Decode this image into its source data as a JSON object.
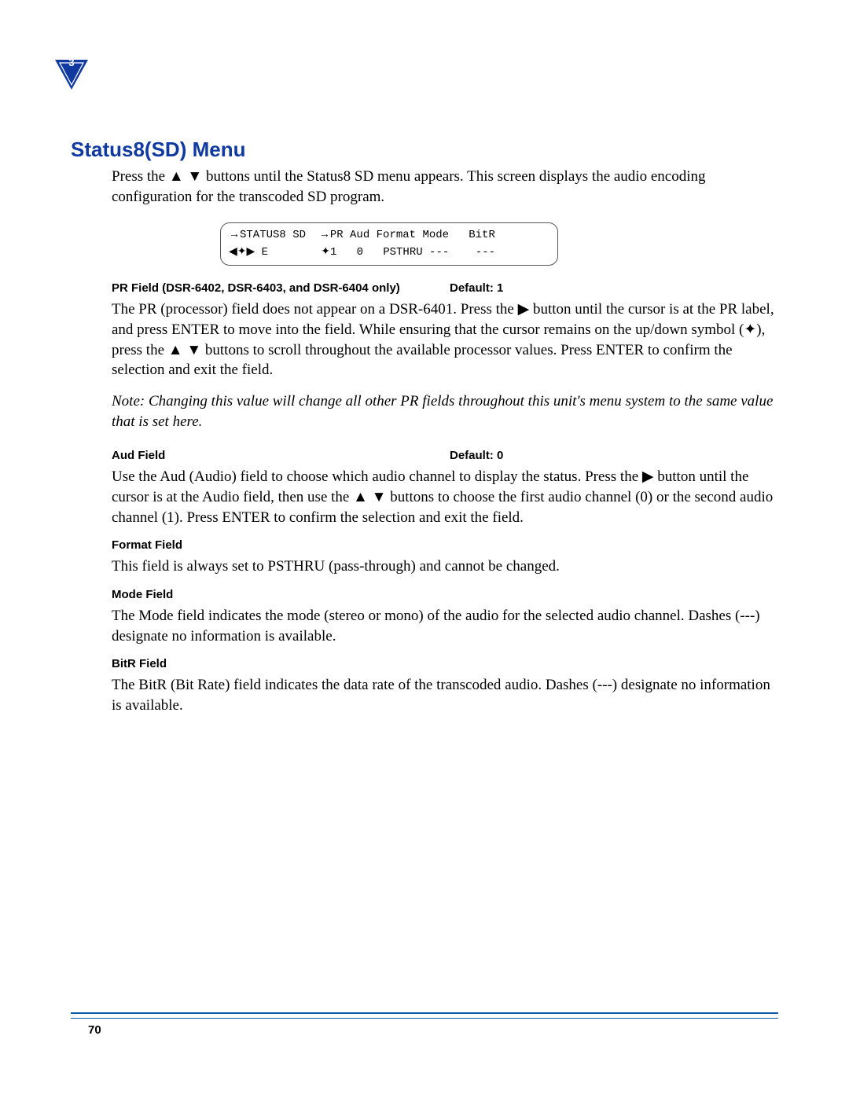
{
  "chapter_number": "3",
  "heading": "Status8(SD) Menu",
  "intro_parts": [
    "Press the ",
    " buttons until the Status8 SD menu appears. This screen displays the audio encoding configuration for the transcoded SD program."
  ],
  "lcd": {
    "line1_a": "STATUS8 SD  ",
    "line1_b": "PR Aud Format Mode   BitR",
    "line2_a": " E        ",
    "line2_b": "1   0   PSTHRU ---    ---"
  },
  "glyphs": {
    "right": "▶",
    "left_right_updown": "◀✦▶",
    "updown": "✦",
    "up_down_sep": "▲ ▼",
    "up": "▲",
    "down": "▼",
    "right_small": "→"
  },
  "fields": {
    "pr": {
      "label": "PR Field (DSR-6402, DSR-6403, and DSR-6404 only)",
      "default": "Default: 1",
      "body_parts": [
        "The PR (processor) field does not appear on a DSR-6401. Press the ",
        " button until the cursor is at the PR label, and press ENTER to move into the field. While ensuring that the cursor remains on the up/down symbol (",
        "), press the ",
        " buttons to scroll throughout the available processor values. Press ENTER to confirm the selection and exit the field."
      ],
      "note": "Note:  Changing this value will change all other PR fields throughout this unit's menu system to the same value that is set here."
    },
    "aud": {
      "label": "Aud Field",
      "default": "Default: 0",
      "body_parts": [
        "Use the Aud (Audio) field to choose which audio channel to display the status. Press the  ",
        " button until the cursor is at the Audio field, then use the ",
        " buttons to choose the first audio channel (0) or the second audio channel (1). Press ENTER to confirm the selection and exit the field."
      ]
    },
    "format": {
      "label": "Format Field",
      "body": "This field is always set to PSTHRU (pass-through) and cannot be changed."
    },
    "mode": {
      "label": "Mode Field",
      "body": "The Mode field indicates the mode (stereo or mono) of the audio for the selected audio channel. Dashes (---) designate no information is available."
    },
    "bitr": {
      "label": "BitR Field",
      "body": "The BitR (Bit Rate) field indicates the data rate of the transcoded audio. Dashes (---) designate no information is available."
    }
  },
  "page_number": "70"
}
